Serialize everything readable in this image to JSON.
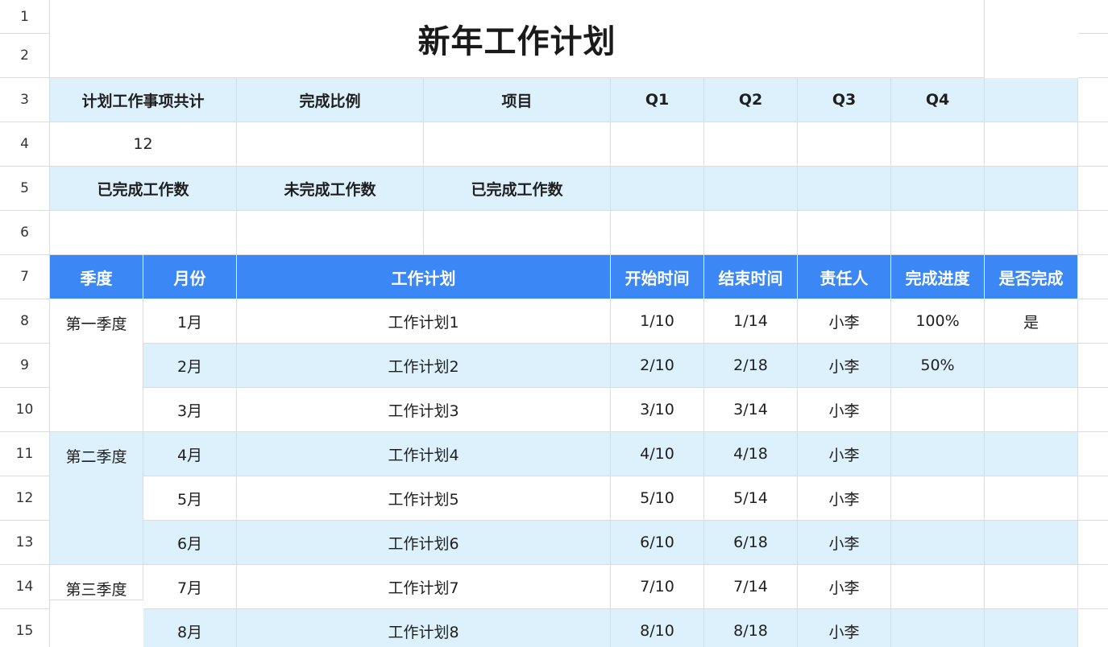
{
  "colors": {
    "light_blue": "#ddf1fc",
    "header_blue": "#3b87f5",
    "white": "#ffffff",
    "grid": "#dcdcdc"
  },
  "row_numbers": [
    "1",
    "2",
    "3",
    "4",
    "5",
    "6",
    "7",
    "8",
    "9",
    "10",
    "11",
    "12",
    "13",
    "14",
    "15"
  ],
  "title": "新年工作计划",
  "summary": {
    "row3": [
      "计划工作事项共计",
      "完成比例",
      "项目",
      "Q1",
      "Q2",
      "Q3",
      "Q4",
      ""
    ],
    "total_count": "12",
    "row5": [
      "已完成工作数",
      "未完成工作数",
      "已完成工作数"
    ]
  },
  "columns": [
    "季度",
    "月份",
    "工作计划",
    "开始时间",
    "结束时间",
    "责任人",
    "完成进度",
    "是否完成"
  ],
  "quarters": [
    {
      "label": "第一季度",
      "rows": 8
    },
    {
      "label": "第二季度",
      "rows": 11
    },
    {
      "label": "第三季度",
      "rows": 14
    }
  ],
  "tasks": [
    {
      "month": "1月",
      "plan": "工作计划1",
      "start": "1/10",
      "end": "1/14",
      "owner": "小李",
      "progress": "100%",
      "done": "是"
    },
    {
      "month": "2月",
      "plan": "工作计划2",
      "start": "2/10",
      "end": "2/18",
      "owner": "小李",
      "progress": "50%",
      "done": ""
    },
    {
      "month": "3月",
      "plan": "工作计划3",
      "start": "3/10",
      "end": "3/14",
      "owner": "小李",
      "progress": "",
      "done": ""
    },
    {
      "month": "4月",
      "plan": "工作计划4",
      "start": "4/10",
      "end": "4/18",
      "owner": "小李",
      "progress": "",
      "done": ""
    },
    {
      "month": "5月",
      "plan": "工作计划5",
      "start": "5/10",
      "end": "5/14",
      "owner": "小李",
      "progress": "",
      "done": ""
    },
    {
      "month": "6月",
      "plan": "工作计划6",
      "start": "6/10",
      "end": "6/18",
      "owner": "小李",
      "progress": "",
      "done": ""
    },
    {
      "month": "7月",
      "plan": "工作计划7",
      "start": "7/10",
      "end": "7/14",
      "owner": "小李",
      "progress": "",
      "done": ""
    },
    {
      "month": "8月",
      "plan": "工作计划8",
      "start": "8/10",
      "end": "8/18",
      "owner": "小李",
      "progress": "",
      "done": ""
    }
  ]
}
